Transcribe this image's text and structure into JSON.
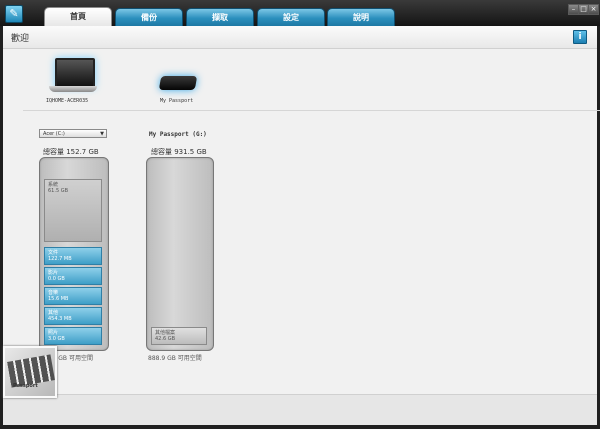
{
  "window": {
    "tabs": [
      {
        "label": "首頁",
        "active": true
      },
      {
        "label": "備份",
        "active": false
      },
      {
        "label": "擷取",
        "active": false
      },
      {
        "label": "設定",
        "active": false
      },
      {
        "label": "說明",
        "active": false
      }
    ],
    "controls": {
      "minimize": "–",
      "maximize": "□",
      "close": "×"
    }
  },
  "page": {
    "title": "歡迎",
    "info_icon": "info-icon"
  },
  "devices": [
    {
      "name": "IQHOME-ACER035",
      "icon": "laptop-icon"
    },
    {
      "name": "My Passport",
      "icon": "external-drive-icon"
    }
  ],
  "drives": {
    "local": {
      "selector": "Acer (C:)",
      "capacity": "總容量 152.7 GB",
      "segments": [
        {
          "label": "系統",
          "size": "61.5 GB",
          "type": "system"
        },
        {
          "label": "文件",
          "size": "122.7 MB",
          "type": "blue"
        },
        {
          "label": "影片",
          "size": "0.0 GB",
          "type": "blue"
        },
        {
          "label": "音樂",
          "size": "15.6 MB",
          "type": "blue"
        },
        {
          "label": "其他",
          "size": "454.3 MB",
          "type": "blue"
        },
        {
          "label": "照片",
          "size": "3.0 GB",
          "type": "blue"
        }
      ],
      "free": "86.0 GB 可用空間"
    },
    "passport": {
      "title": "My Passport (G:)",
      "capacity": "總容量 931.5 GB",
      "segments": [
        {
          "label": "其他檔案",
          "size": "42.6 GB",
          "type": "other"
        }
      ],
      "free": "888.9 GB 可用空間"
    }
  },
  "footer": {
    "thumbnail_brand": "Passport"
  },
  "colors": {
    "accent": "#2b8fbd",
    "segment_blue": "#4aa7cf",
    "background": "#f1f1f1"
  }
}
